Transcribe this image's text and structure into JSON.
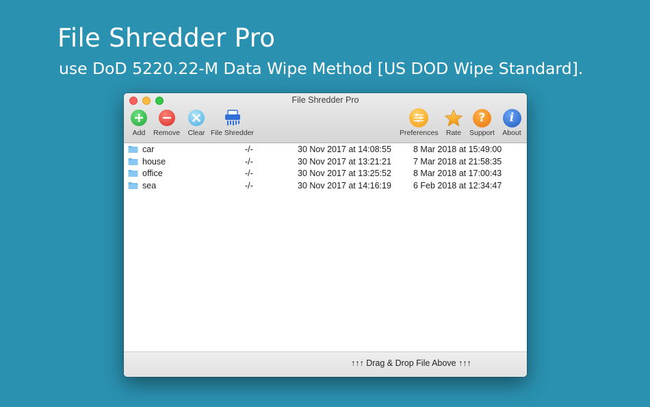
{
  "hero": {
    "title": "File Shredder Pro",
    "subtitle": "use DoD 5220.22-M Data Wipe Method [US DOD Wipe Standard]."
  },
  "window": {
    "title": "File Shredder Pro"
  },
  "toolbar": {
    "add": "Add",
    "remove": "Remove",
    "clear": "Clear",
    "shredder": "File Shredder",
    "preferences": "Preferences",
    "rate": "Rate",
    "support": "Support",
    "about": "About"
  },
  "files": [
    {
      "name": "car",
      "size": "-/-",
      "created": "30 Nov 2017 at 14:08:55",
      "modified": "8 Mar 2018 at 15:49:00"
    },
    {
      "name": "house",
      "size": "-/-",
      "created": "30 Nov 2017 at 13:21:21",
      "modified": "7 Mar 2018 at 21:58:35"
    },
    {
      "name": "office",
      "size": "-/-",
      "created": "30 Nov 2017 at 13:25:52",
      "modified": "8 Mar 2018 at 17:00:43"
    },
    {
      "name": "sea",
      "size": "-/-",
      "created": "30 Nov 2017 at 14:16:19",
      "modified": "6 Feb 2018 at 12:34:47"
    }
  ],
  "footer": {
    "hint": "↑↑↑ Drag & Drop File Above ↑↑↑"
  },
  "colors": {
    "background": "#2a91b0",
    "add": "#2fbf4c",
    "remove": "#e8463a",
    "clear": "#6fc3ea",
    "shredder": "#2f6fd6",
    "preferences": "#f6a51e",
    "rate": "#f7b52a",
    "support": "#f08a18",
    "about": "#2f6fd6",
    "folder": "#6bb6ea"
  },
  "icons": {
    "add": "plus-circle-icon",
    "remove": "minus-circle-icon",
    "clear": "x-circle-icon",
    "shredder": "shredder-icon",
    "preferences": "sliders-icon",
    "rate": "star-icon",
    "support": "question-icon",
    "about": "info-icon",
    "folder": "folder-icon"
  }
}
